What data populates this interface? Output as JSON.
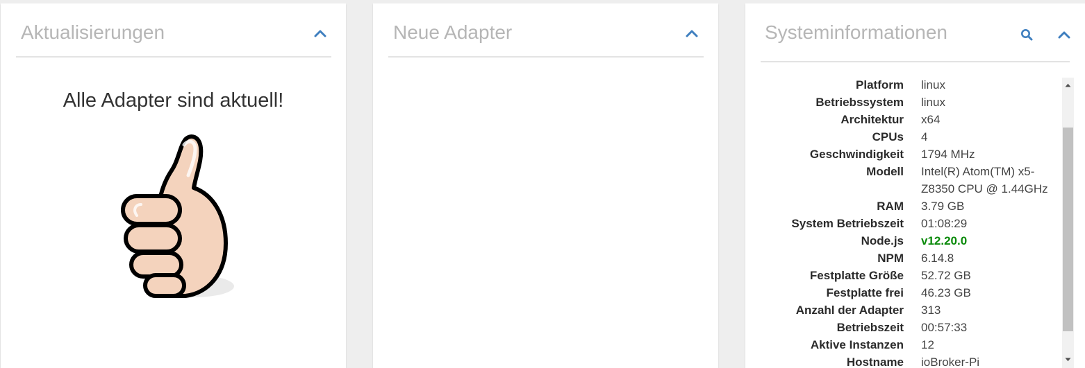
{
  "updates_card": {
    "title": "Aktualisierungen",
    "message": "Alle Adapter sind aktuell!",
    "collapse_icon": "chevron-up-icon",
    "image": "thumbs-up-icon"
  },
  "new_adapters_card": {
    "title": "Neue Adapter",
    "collapse_icon": "chevron-up-icon"
  },
  "system_card": {
    "title": "Systeminformationen",
    "search_icon": "search-icon",
    "collapse_icon": "chevron-up-icon",
    "rows": [
      {
        "key": "Platform",
        "value": "linux"
      },
      {
        "key": "Betriebssystem",
        "value": "linux"
      },
      {
        "key": "Architektur",
        "value": "x64"
      },
      {
        "key": "CPUs",
        "value": "4"
      },
      {
        "key": "Geschwindigkeit",
        "value": "1794 MHz"
      },
      {
        "key": "Modell",
        "value": "Intel(R) Atom(TM) x5-Z8350 CPU @ 1.44GHz"
      },
      {
        "key": "RAM",
        "value": "3.79 GB"
      },
      {
        "key": "System Betriebszeit",
        "value": "01:08:29"
      },
      {
        "key": "Node.js",
        "value": "v12.20.0"
      },
      {
        "key": "NPM",
        "value": "6.14.8"
      },
      {
        "key": "Festplatte Größe",
        "value": "52.72 GB"
      },
      {
        "key": "Festplatte frei",
        "value": "46.23 GB"
      },
      {
        "key": "Anzahl der Adapter",
        "value": "313"
      },
      {
        "key": "Betriebszeit",
        "value": "00:57:33"
      },
      {
        "key": "Aktive Instanzen",
        "value": "12"
      },
      {
        "key": "Hostname",
        "value": "ioBroker-Pi"
      }
    ]
  },
  "colors": {
    "accent": "#3f7fbf",
    "title_gray": "#b6b6b6",
    "node_version_green": "#0a8a0a",
    "background": "#eeeeee"
  }
}
